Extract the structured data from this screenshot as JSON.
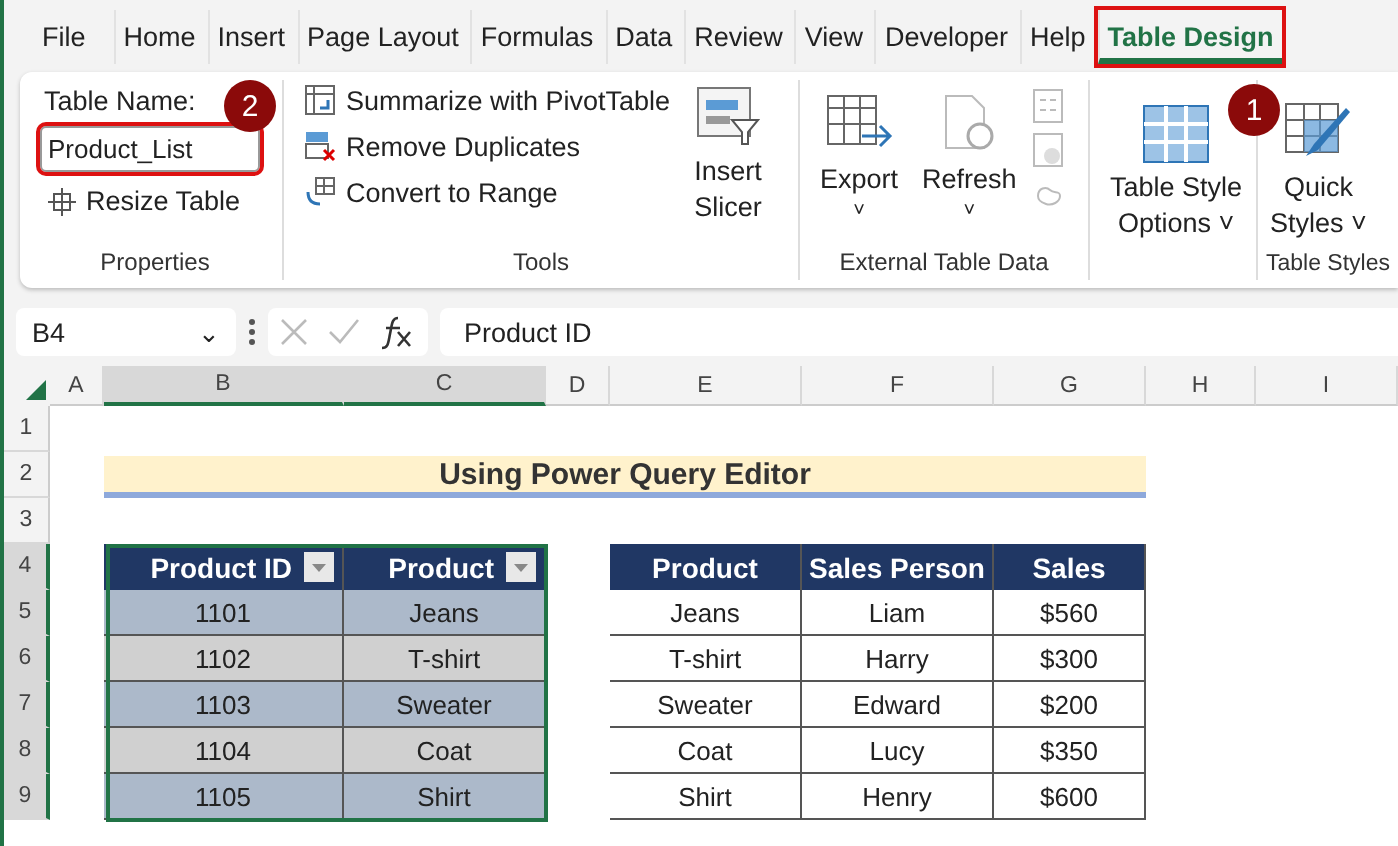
{
  "menu_tabs": [
    {
      "label": "File",
      "selected": false,
      "highlighted": false
    },
    {
      "label": "Home",
      "selected": false,
      "highlighted": false
    },
    {
      "label": "Insert",
      "selected": false,
      "highlighted": false
    },
    {
      "label": "Page Layout",
      "selected": false,
      "highlighted": false
    },
    {
      "label": "Formulas",
      "selected": false,
      "highlighted": false
    },
    {
      "label": "Data",
      "selected": false,
      "highlighted": false
    },
    {
      "label": "Review",
      "selected": false,
      "highlighted": false
    },
    {
      "label": "View",
      "selected": false,
      "highlighted": false
    },
    {
      "label": "Developer",
      "selected": false,
      "highlighted": false
    },
    {
      "label": "Help",
      "selected": false,
      "highlighted": false
    },
    {
      "label": "Table Design",
      "selected": true,
      "highlighted": true
    }
  ],
  "callouts": [
    "2",
    "1"
  ],
  "ribbon": {
    "properties": {
      "name_label": "Table Name:",
      "name_value": "Product_List",
      "name_highlighted": true,
      "resize": "Resize Table",
      "group_label": "Properties"
    },
    "tools": {
      "items": [
        "Summarize with PivotTable",
        "Remove Duplicates",
        "Convert to Range"
      ],
      "slicer": [
        "Insert",
        "Slicer"
      ],
      "group_label": "Tools"
    },
    "external": {
      "export": "Export",
      "refresh": "Refresh",
      "caret": "˅",
      "group_label": "External Table Data"
    },
    "style_options": {
      "lines": [
        "Table Style",
        "Options ˅"
      ]
    },
    "styles": {
      "lines": [
        "Quick",
        "Styles ˅"
      ],
      "group_label": "Table Styles"
    }
  },
  "formula_bar": {
    "name_box": "B4",
    "caret": "⌄",
    "formula": "Product ID"
  },
  "columns": [
    "A",
    "B",
    "C",
    "D",
    "E",
    "F",
    "G",
    "H",
    "I"
  ],
  "rows": [
    "1",
    "2",
    "3",
    "4",
    "5",
    "6",
    "7",
    "8",
    "9"
  ],
  "title": "Using Power Query Editor",
  "table_1": {
    "headers": [
      "Product ID",
      "Product"
    ],
    "rows": [
      [
        "1101",
        "Jeans"
      ],
      [
        "1102",
        "T-shirt"
      ],
      [
        "1103",
        "Sweater"
      ],
      [
        "1104",
        "Coat"
      ],
      [
        "1105",
        "Shirt"
      ]
    ]
  },
  "table_2": {
    "headers": [
      "Product",
      "Sales Person",
      "Sales"
    ],
    "rows": [
      [
        "Jeans",
        "Liam",
        "$560"
      ],
      [
        "T-shirt",
        "Harry",
        "$300"
      ],
      [
        "Sweater",
        "Edward",
        "$200"
      ],
      [
        "Coat",
        "Lucy",
        "$350"
      ],
      [
        "Shirt",
        "Henry",
        "$600"
      ]
    ]
  }
}
